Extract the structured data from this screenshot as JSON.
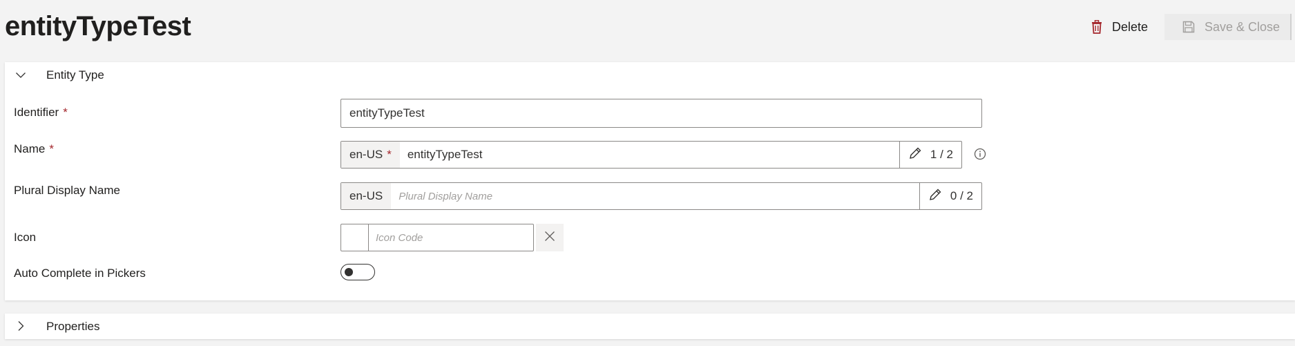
{
  "page": {
    "title": "entityTypeTest"
  },
  "commands": {
    "delete_label": "Delete",
    "save_close_label": "Save & Close",
    "delete_icon": "trash-icon",
    "save_icon": "floppy-disk-icon",
    "delete_color": "#a4262c"
  },
  "entity_section": {
    "title": "Entity Type",
    "expanded": true,
    "fields": {
      "identifier": {
        "label": "Identifier",
        "required_mark": "*",
        "value": "entityTypeTest"
      },
      "name": {
        "label": "Name",
        "required_mark": "*",
        "locale": "en-US",
        "locale_required_mark": "*",
        "value": "entityTypeTest",
        "count": "1 / 2"
      },
      "plural_display_name": {
        "label": "Plural Display Name",
        "locale": "en-US",
        "placeholder": "Plural Display Name",
        "count": "0 / 2"
      },
      "icon": {
        "label": "Icon",
        "placeholder": "Icon Code"
      },
      "auto_complete": {
        "label": "Auto Complete in Pickers",
        "enabled": false
      }
    }
  },
  "properties_section": {
    "title": "Properties",
    "expanded": false
  }
}
